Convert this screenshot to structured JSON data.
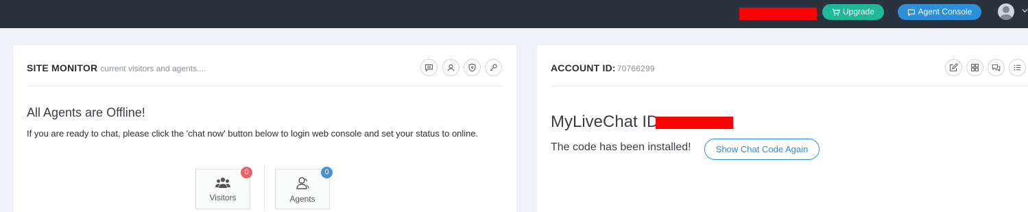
{
  "topbar": {
    "upgrade_label": "Upgrade",
    "console_label": "Agent Console",
    "colors": {
      "background": "#2a323e",
      "upgrade": "#1fb898",
      "console": "#2e8fd9"
    }
  },
  "site_monitor": {
    "title": "SITE MONITOR",
    "subtitle": "current visitors and agents....",
    "header_icons": [
      "chat-bubble-icon",
      "user-circle-icon",
      "shield-icon",
      "key-icon"
    ],
    "offline_title": "All Agents are Offline!",
    "offline_text": "If you are ready to chat, please click the 'chat now' button below to login web console and set your status to online.",
    "stats": [
      {
        "label": "Visitors",
        "count": "0",
        "icon": "users-group-icon",
        "badge_color": "#e8636b"
      },
      {
        "label": "Agents",
        "count": "0",
        "icon": "agent-icon",
        "badge_color": "#4a90d9"
      }
    ]
  },
  "account": {
    "title": "ACCOUNT ID:",
    "id_value": "70766299",
    "header_icons": [
      "edit-icon",
      "grid-icon",
      "chat-bubbles-icon",
      "list-icon"
    ],
    "mylivechat_label": "MyLiveChat ID:",
    "installed_text": "The code has been installed!",
    "show_code_label": "Show Chat Code Again",
    "accent": "#2e8fd9"
  }
}
